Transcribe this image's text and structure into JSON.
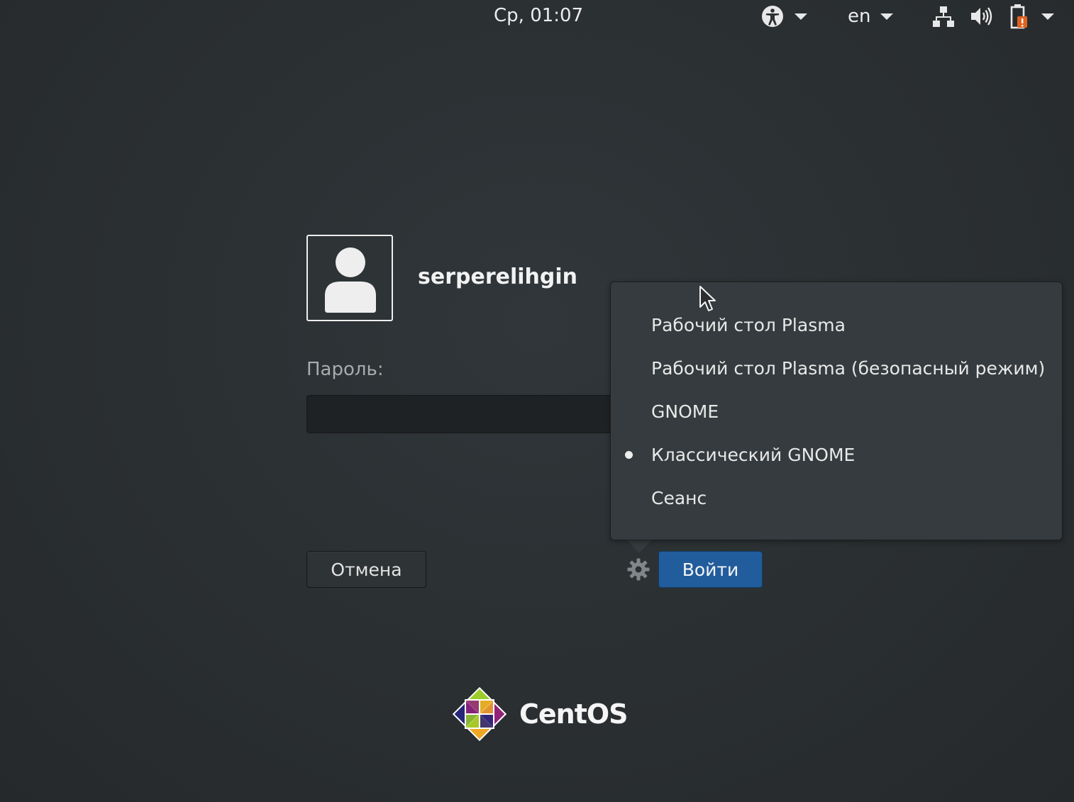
{
  "topbar": {
    "clock": "Ср, 01:07",
    "accessibility_icon": "accessibility-icon",
    "language": "en",
    "system_icons": [
      "network-icon",
      "volume-icon",
      "battery-icon"
    ]
  },
  "login": {
    "username": "serperelihgin",
    "password_label": "Пароль:",
    "password_value": "",
    "cancel_label": "Отмена",
    "login_label": "Войти"
  },
  "session_menu": {
    "items": [
      {
        "label": "Рабочий стол Plasma",
        "selected": false
      },
      {
        "label": "Рабочий стол Plasma (безопасный режим)",
        "selected": false
      },
      {
        "label": "GNOME",
        "selected": false
      },
      {
        "label": "Классический GNOME",
        "selected": true
      },
      {
        "label": "Сеанс",
        "selected": false
      }
    ]
  },
  "brand": {
    "name": "CentOS"
  },
  "colors": {
    "background": "#2b3032",
    "menu_bg": "#353b3e",
    "login_button": "#215d9c",
    "battery_warning": "#e0621f"
  }
}
